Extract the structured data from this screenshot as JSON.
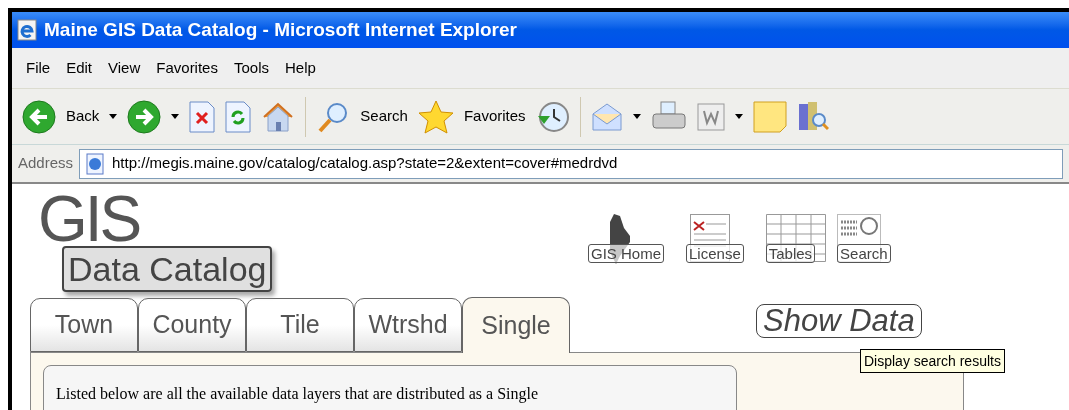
{
  "window": {
    "title": "Maine GIS Data Catalog - Microsoft Internet Explorer"
  },
  "menu": [
    "File",
    "Edit",
    "View",
    "Favorites",
    "Tools",
    "Help"
  ],
  "toolbar": {
    "back_label": "Back",
    "search_label": "Search",
    "favorites_label": "Favorites"
  },
  "address_bar": {
    "label": "Address",
    "url": "http://megis.maine.gov/catalog/catalog.asp?state=2&extent=cover#medrdvd"
  },
  "logo": {
    "big_text": "GIS",
    "text": "Data Catalog"
  },
  "nav_links": [
    {
      "kind": "home",
      "label": "GIS Home"
    },
    {
      "kind": "license",
      "label": "License"
    },
    {
      "kind": "tables",
      "label": "Tables"
    },
    {
      "kind": "search",
      "label": "Search"
    }
  ],
  "tabs": [
    {
      "label": "Town",
      "selected": false
    },
    {
      "label": "County",
      "selected": false
    },
    {
      "label": "Tile",
      "selected": false
    },
    {
      "label": "Wtrshd",
      "selected": false
    },
    {
      "label": "Single",
      "selected": true
    }
  ],
  "show_data_button": "Show Data",
  "tooltip": "Display search results",
  "intro_text": "Listed below are all the available data layers that are distributed as a Single"
}
